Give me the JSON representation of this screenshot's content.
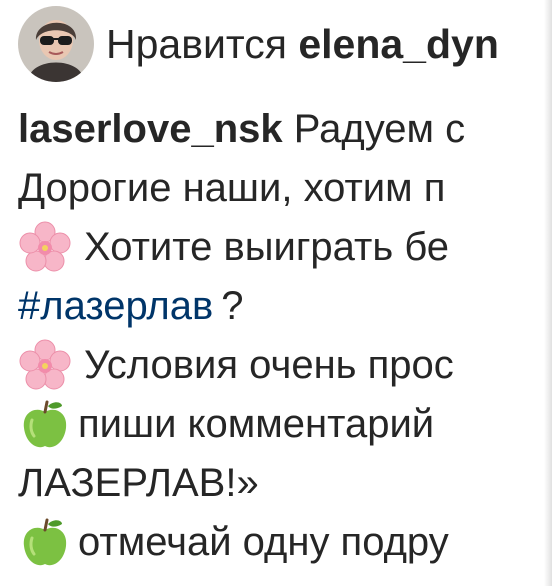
{
  "likes": {
    "prefix": "Нравится",
    "username": "elena_dyn",
    "avatar_icon": "user-avatar"
  },
  "caption": {
    "author": "laserlove_nsk",
    "line1_rest": "Радуем с",
    "line2": "Дорогие наши, хотим п",
    "line3_icon": "cherry-blossom-icon",
    "line3": "Хотите выиграть бе",
    "hashtag": "#лазерлав",
    "line4_rest": "?",
    "line5_icon": "cherry-blossom-icon",
    "line5": "Условия очень прос",
    "line6_icon": "green-apple-icon",
    "line6": "пиши комментарий",
    "line7": "ЛАЗЕРЛАВ!»",
    "line8_icon": "green-apple-icon",
    "line8": "отмечай одну подру"
  },
  "colors": {
    "text": "#262626",
    "hashtag": "#003569"
  }
}
